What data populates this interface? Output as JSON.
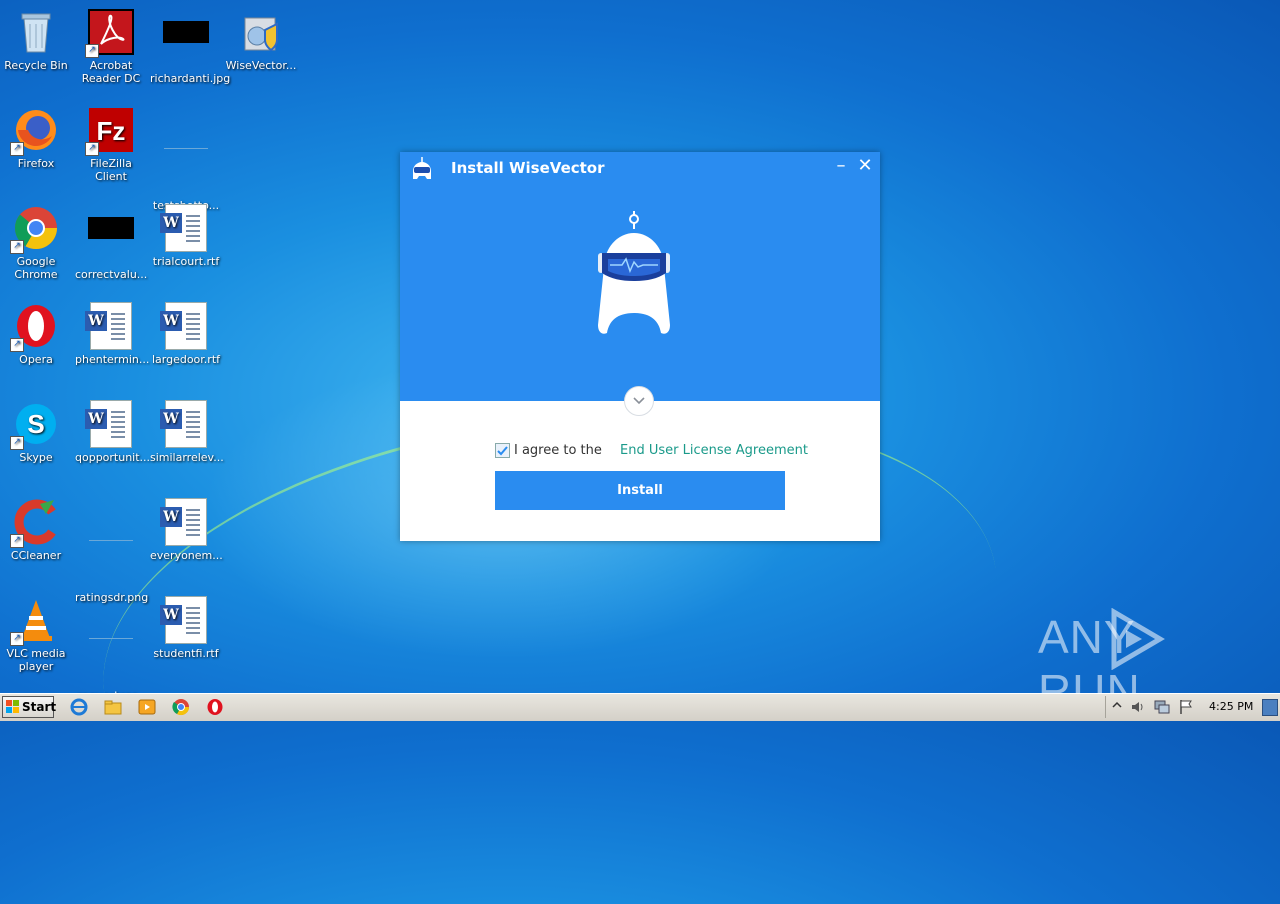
{
  "desktop": {
    "icons": [
      {
        "label": "Recycle Bin"
      },
      {
        "label": "Acrobat Reader DC"
      },
      {
        "label": "richardanti.jpg"
      },
      {
        "label": "WiseVector..."
      },
      {
        "label": "Firefox"
      },
      {
        "label": "FileZilla Client"
      },
      {
        "label": "testsbotto..."
      },
      {
        "label": "Google Chrome"
      },
      {
        "label": "correctvalu..."
      },
      {
        "label": "trialcourt.rtf"
      },
      {
        "label": "Opera"
      },
      {
        "label": "phentermin..."
      },
      {
        "label": "largedoor.rtf"
      },
      {
        "label": "Skype"
      },
      {
        "label": "qopportunit..."
      },
      {
        "label": "similarrelev..."
      },
      {
        "label": "CCleaner"
      },
      {
        "label": "ratingsdr.png"
      },
      {
        "label": "everyonem..."
      },
      {
        "label": "VLC media player"
      },
      {
        "label": "requestcar..."
      },
      {
        "label": "studentfi.rtf"
      }
    ]
  },
  "dialog": {
    "title": "Install WiseVector",
    "agree_text": "I agree to the",
    "eula_link": "End User License Agreement",
    "install_label": "Install",
    "agree_checked": true,
    "accent_color": "#2a8cf0"
  },
  "watermark": {
    "text_left": "ANY",
    "text_right": "RUN"
  },
  "taskbar": {
    "start_label": "Start",
    "clock": "4:25 PM"
  }
}
